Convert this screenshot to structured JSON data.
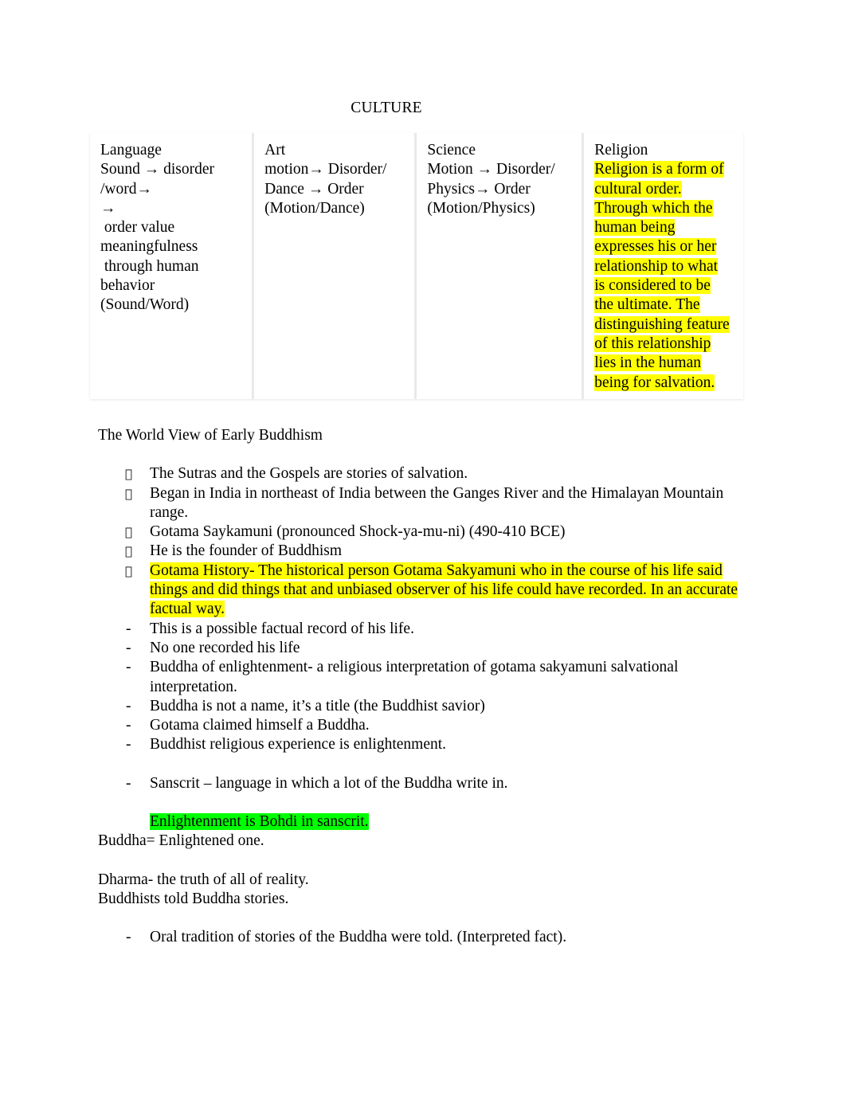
{
  "document": {
    "title": "CULTURE",
    "table": {
      "columns": [
        {
          "header": "Language",
          "lines": [
            "Sound → disorder",
            "/word→",
            "→",
            " order value",
            "meaningfulness",
            " through human",
            "behavior",
            "(Sound/Word)"
          ],
          "highlight": "none"
        },
        {
          "header": "Art",
          "lines": [
            "motion→ Disorder/",
            "Dance → Order",
            "(Motion/Dance)"
          ],
          "highlight": "none"
        },
        {
          "header": "Science",
          "lines": [
            "Motion → Disorder/",
            "Physics→ Order",
            "(Motion/Physics)"
          ],
          "highlight": "none"
        },
        {
          "header": "Religion",
          "lines": [
            "Religion is a form of",
            "cultural order.",
            "Through which the",
            "human being",
            "expresses his or her",
            "relationship to what",
            "is considered to be",
            "the ultimate. The",
            "distinguishing feature",
            "of this relationship",
            "lies in the human",
            "being for salvation."
          ],
          "highlight": "yellow"
        }
      ]
    },
    "heading_worldview": "The World View of Early Buddhism",
    "symbol_bullets": [
      {
        "text": "The Sutras and the Gospels are stories of salvation.",
        "highlight": "none"
      },
      {
        "text": "Began in India in northeast of India between the Ganges River and the Himalayan Mountain range.",
        "highlight": "none"
      },
      {
        "text": "Gotama Saykamuni (pronounced Shock-ya-mu-ni) (490-410 BCE)",
        "highlight": "none"
      },
      {
        "text": "He is the founder of Buddhism",
        "highlight": "none"
      },
      {
        "text": "Gotama History- The historical person Gotama Sakyamuni who in the course of his life said things and did things that and unbiased observer of his life could have recorded. In an accurate factual way.",
        "highlight": "yellow"
      }
    ],
    "dash_bullets": [
      {
        "text": "This is a possible factual record of his life."
      },
      {
        "text": "No one recorded his life"
      },
      {
        "text": "Buddha of enlightenment- a religious interpretation of gotama sakyamuni salvational interpretation."
      },
      {
        "text": "Buddha is not a name, it’s a title (the Buddhist savior)"
      },
      {
        "text": "Gotama claimed himself a Buddha."
      },
      {
        "text": "Buddhist religious experience is enlightenment."
      }
    ],
    "dash_bullet_sanscrit": "Sanscrit – language in which a lot of the Buddha write in.",
    "highlighted_green_line": "Enlightenment is Bohdi in sanscrit.",
    "line_buddha_equals": "Buddha= Enlightened one.",
    "line_dharma": "Dharma- the truth of all of reality.",
    "line_buddhists_told": "Buddhists told Buddha stories.",
    "dash_bullet_oral": "Oral tradition of stories of the Buddha were told. (Interpreted fact).",
    "markers": {
      "symbol_bullet": "",
      "dash_bullet": "-",
      "arrow_glyph": ""
    },
    "colors": {
      "highlight_yellow": "#ffff00",
      "highlight_green": "#00ff00",
      "text": "#000000",
      "page_background": "#ffffff",
      "table_gridline": "#e9e9e9"
    }
  }
}
